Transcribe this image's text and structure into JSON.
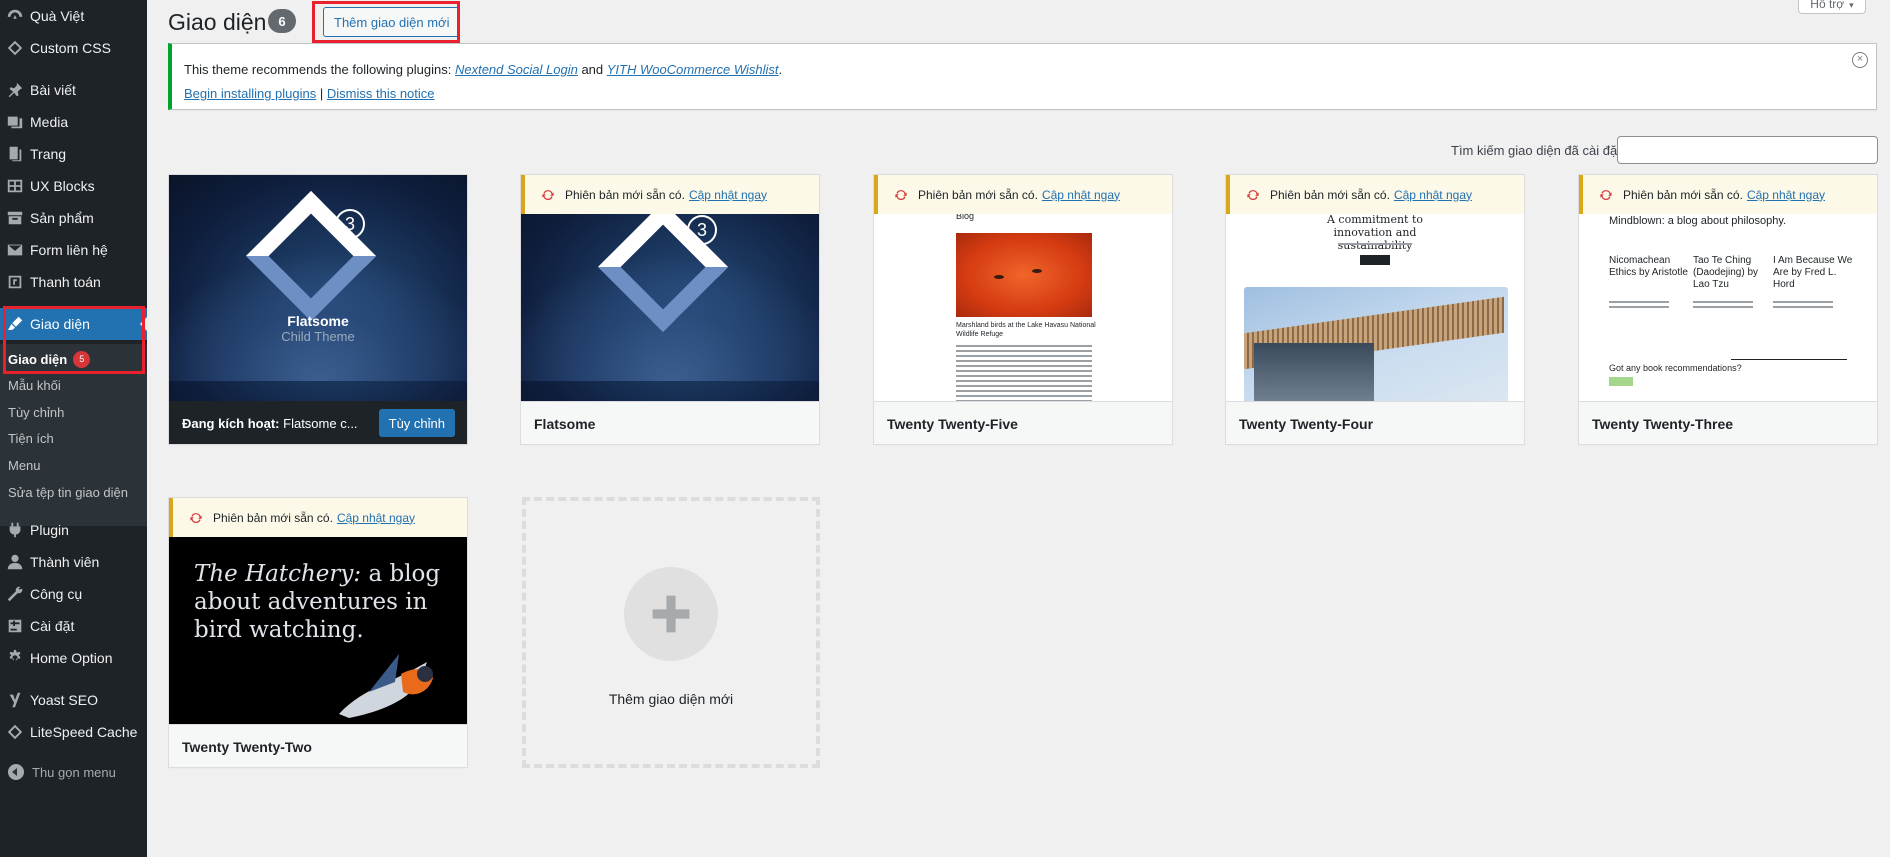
{
  "sidebar": {
    "items": [
      {
        "label": "Quà Việt",
        "icon": "gauge-icon"
      },
      {
        "label": "Custom CSS",
        "icon": "diamond-icon"
      },
      {
        "label": "Bài viết",
        "icon": "pin-icon"
      },
      {
        "label": "Media",
        "icon": "media-icon"
      },
      {
        "label": "Trang",
        "icon": "page-icon"
      },
      {
        "label": "UX Blocks",
        "icon": "blocks-icon"
      },
      {
        "label": "Sản phẩm",
        "icon": "archive-icon"
      },
      {
        "label": "Form liên hệ",
        "icon": "mail-icon"
      },
      {
        "label": "Thanh toán",
        "icon": "payment-icon"
      },
      {
        "label": "Giao diện",
        "icon": "brush-icon"
      },
      {
        "label": "Plugin",
        "icon": "plug-icon"
      },
      {
        "label": "Thành viên",
        "icon": "user-icon"
      },
      {
        "label": "Công cụ",
        "icon": "wrench-icon"
      },
      {
        "label": "Cài đặt",
        "icon": "settings-icon"
      },
      {
        "label": "Home Option",
        "icon": "gear-icon"
      },
      {
        "label": "Yoast SEO",
        "icon": "yoast-icon"
      },
      {
        "label": "LiteSpeed Cache",
        "icon": "diamond-icon"
      }
    ],
    "submenu": [
      {
        "label": "Giao diện",
        "count": "5"
      },
      {
        "label": "Mẫu khối"
      },
      {
        "label": "Tùy chỉnh"
      },
      {
        "label": "Tiện ích"
      },
      {
        "label": "Menu"
      },
      {
        "label": "Sửa tệp tin giao diện"
      }
    ],
    "collapse_label": "Thu gọn menu"
  },
  "header": {
    "title": "Giao diện",
    "count": "6",
    "add_button": "Thêm giao diện mới",
    "help_tab": "Hỗ trợ"
  },
  "notice": {
    "text_before": "This theme recommends the following plugins: ",
    "plugin1": "Nextend Social Login",
    "and": " and ",
    "plugin2": "YITH WooCommerce Wishlist",
    "period": ".",
    "begin_link": "Begin installing plugins",
    "separator": " | ",
    "dismiss_link": "Dismiss this notice"
  },
  "search": {
    "label": "Tìm kiếm giao diện đã cài đặt",
    "value": ""
  },
  "update_notice": {
    "text": "Phiên bản mới sẵn có.",
    "link": "Cập nhật ngay"
  },
  "themes": [
    {
      "name": "Flatsome Child Theme",
      "active_prefix": "Đang kích hoạt:",
      "active_name": "Flatsome c...",
      "customize": "Tùy chỉnh",
      "logo_number": "3",
      "shot_title": "Flatsome",
      "shot_subtitle": "Child Theme"
    },
    {
      "name": "Flatsome",
      "logo_number": "3"
    },
    {
      "name": "Twenty Twenty-Five",
      "shot_heading": "Blog",
      "shot_caption": "Marshland birds at the Lake Havasu National Wildlife Refuge"
    },
    {
      "name": "Twenty Twenty-Four",
      "shot_heading": "A commitment to innovation and sustainability"
    },
    {
      "name": "Twenty Twenty-Three",
      "shot_heading": "Mindblown: a blog about philosophy.",
      "posts": [
        "Nicomachean Ethics by Aristotle",
        "Tao Te Ching (Daodejing) by Lao Tzu",
        "I Am Because We Are by Fred L. Hord"
      ],
      "cta": "Got any book recommendations?"
    },
    {
      "name": "Twenty Twenty-Two",
      "shot_title_italic": "The Hatchery:",
      "shot_title_rest": " a blog about adventures in bird watching."
    }
  ],
  "add_new": {
    "label": "Thêm giao diện mới"
  },
  "colors": {
    "accent": "#2271b1",
    "sidebar_bg": "#1d2327",
    "notice_border": "#00a32a",
    "update_border": "#dba617",
    "highlight_box": "#e8212c"
  }
}
